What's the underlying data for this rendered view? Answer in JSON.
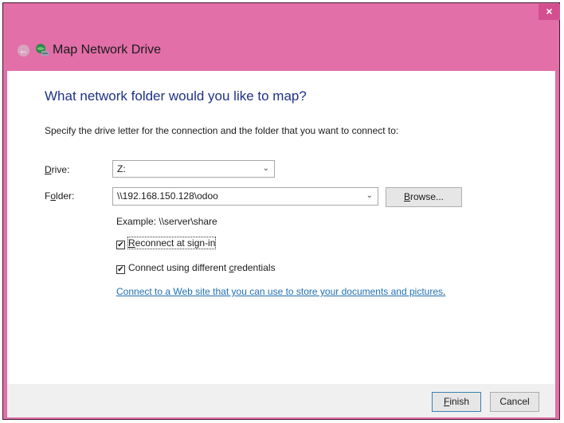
{
  "window": {
    "title": "Map Network Drive",
    "close_label": "×",
    "back_icon": "back-arrow-icon",
    "app_icon": "network-drive-icon",
    "accent_color": "#e26fa8"
  },
  "main": {
    "heading": "What network folder would you like to map?",
    "instruction": "Specify the drive letter for the connection and the folder that you want to connect to:",
    "drive": {
      "label": "Drive:",
      "value": "Z:"
    },
    "folder": {
      "label": "Folder:",
      "value": "\\\\192.168.150.128\\odoo"
    },
    "browse_label": "Browse...",
    "example": "Example: \\\\server\\share",
    "reconnect": {
      "label": "Reconnect at sign-in",
      "checked": true
    },
    "credentials": {
      "label": "Connect using different credentials",
      "checked": true
    },
    "link_text": "Connect to a Web site that you can use to store your documents and pictures",
    "link_suffix": "."
  },
  "footer": {
    "finish_label": "Finish",
    "cancel_label": "Cancel"
  }
}
